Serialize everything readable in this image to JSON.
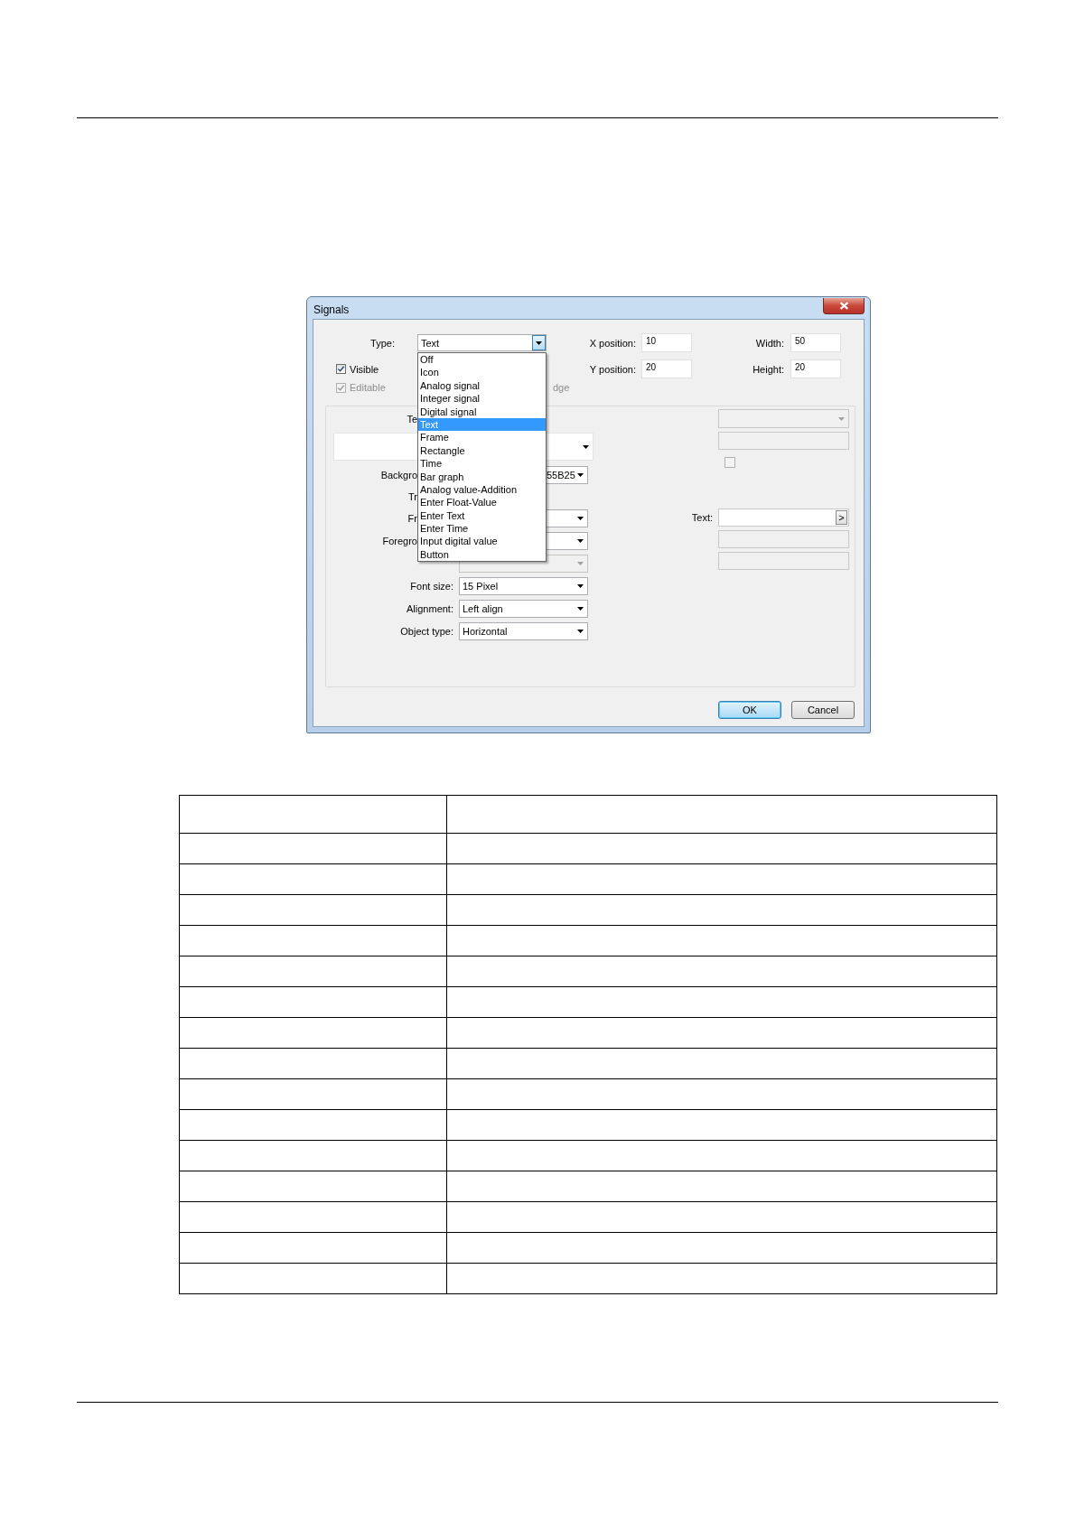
{
  "dialog": {
    "title": "Signals",
    "type": {
      "label": "Type:",
      "value": "Text",
      "expanded": true,
      "options": [
        {
          "label": "Off",
          "selected": false
        },
        {
          "label": "Icon",
          "selected": false
        },
        {
          "label": "Analog signal",
          "selected": false
        },
        {
          "label": "Integer signal",
          "selected": false
        },
        {
          "label": "Digital signal",
          "selected": false
        },
        {
          "label": "Text",
          "selected": true
        },
        {
          "label": "Frame",
          "selected": false
        },
        {
          "label": "Rectangle",
          "selected": false
        },
        {
          "label": "Time",
          "selected": false
        },
        {
          "label": "Bar graph",
          "selected": false
        },
        {
          "label": "Analog value-Addition",
          "selected": false
        },
        {
          "label": "Enter Float-Value",
          "selected": false
        },
        {
          "label": "Enter Text",
          "selected": false
        },
        {
          "label": "Enter Time",
          "selected": false
        },
        {
          "label": "Input digital value",
          "selected": false
        },
        {
          "label": "Button",
          "selected": false
        }
      ]
    },
    "position_fields": [
      {
        "label": "X position:",
        "value": "10"
      },
      {
        "label": "Width:",
        "value": "50"
      },
      {
        "label": "Y position:",
        "value": "20"
      },
      {
        "label": "Height:",
        "value": "20"
      }
    ],
    "visible": {
      "label": "Visible",
      "checked": true,
      "disabled": false
    },
    "editable": {
      "label": "Editable",
      "checked": true,
      "disabled": true
    },
    "cut_label": "dge",
    "properties": [
      {
        "kind": "label",
        "label": "Te"
      },
      {
        "kind": "wide-combo"
      },
      {
        "kind": "combo",
        "label": "Backgro",
        "value": "55B25",
        "disabled": false
      },
      {
        "kind": "label",
        "label": "Tr"
      },
      {
        "kind": "combo",
        "label": "Fr",
        "disabled": false
      },
      {
        "kind": "combo",
        "label": "Foregro",
        "disabled": false
      },
      {
        "kind": "combo",
        "disabled": true
      },
      {
        "kind": "combo",
        "label": "Font size:",
        "value": "15 Pixel",
        "disabled": false
      },
      {
        "kind": "combo",
        "label": "Alignment:",
        "value": "Left align",
        "disabled": false
      },
      {
        "kind": "combo",
        "label": "Object type:",
        "value": "Horizontal",
        "disabled": false
      }
    ],
    "side": [
      {
        "kind": "combo",
        "disabled": true
      },
      {
        "kind": "field",
        "disabled": true
      },
      {
        "kind": "checkbox",
        "checked": false,
        "disabled": true
      },
      {
        "kind": "text-field",
        "label": "Text:",
        "button": ">"
      },
      {
        "kind": "field",
        "disabled": true
      },
      {
        "kind": "field",
        "disabled": true
      }
    ],
    "buttons": [
      {
        "label": "OK",
        "default": true
      },
      {
        "label": "Cancel",
        "default": false
      }
    ]
  }
}
